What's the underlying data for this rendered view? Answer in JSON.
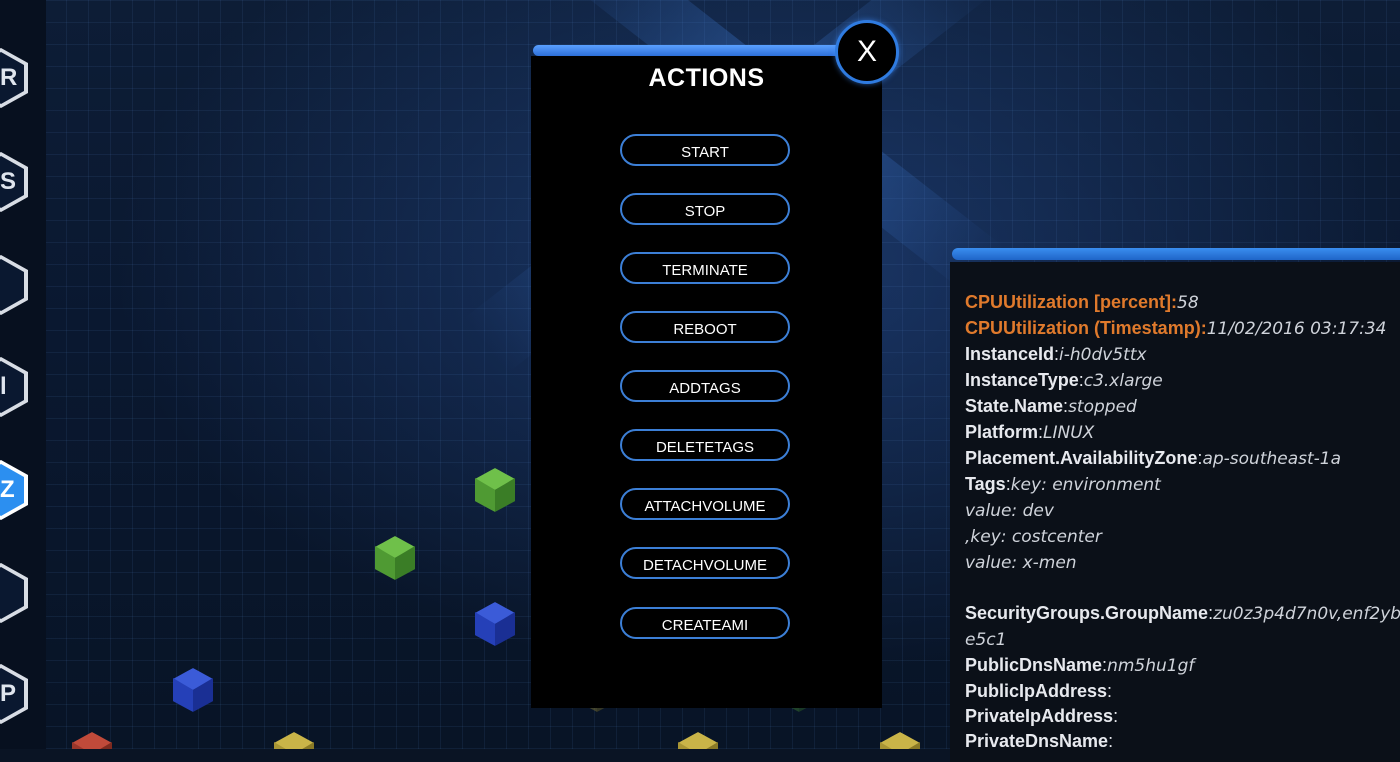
{
  "colors": {
    "accent": "#2f7be0",
    "highlight": "#e07a2c",
    "panel": "#000000"
  },
  "sidebar": {
    "items": [
      {
        "icon": "hex-r-icon",
        "glyph": "R"
      },
      {
        "icon": "hex-s-icon",
        "glyph": "S"
      },
      {
        "icon": "hex-database-icon",
        "glyph": ""
      },
      {
        "icon": "hex-bars-icon",
        "glyph": "l"
      },
      {
        "icon": "hex-active-icon",
        "glyph": "Z"
      },
      {
        "icon": "hex-lock-icon",
        "glyph": ""
      },
      {
        "icon": "hex-p-icon",
        "glyph": "P"
      }
    ]
  },
  "actions": {
    "title": "ACTIONS",
    "close_label": "X",
    "buttons": [
      "START",
      "STOP",
      "TERMINATE",
      "REBOOT",
      "ADDTAGS",
      "DELETETAGS",
      "ATTACHVOLUME",
      "DETACHVOLUME",
      "CREATEAMI"
    ]
  },
  "details": {
    "cpu_percent_key": "CPUUtilization [percent]",
    "cpu_percent_value": "58",
    "cpu_ts_key": "CPUUtilization (Timestamp)",
    "cpu_ts_value": "11/02/2016 03:17:34",
    "instance_id_key": "InstanceId",
    "instance_id_value": "i-h0dv5ttx",
    "instance_type_key": "InstanceType",
    "instance_type_value": "c3.xlarge",
    "state_key": "State.Name",
    "state_value": "stopped",
    "platform_key": "Platform",
    "platform_value": "LINUX",
    "zone_key": "Placement.AvailabilityZone",
    "zone_value": "ap-southeast-1a",
    "tags_key": "Tags",
    "tags_line1": "key: environment",
    "tags_line2": "value: dev",
    "tags_line3": ",key: costcenter",
    "tags_line4": "value: x-men",
    "sg_key": "SecurityGroups.GroupName",
    "sg_value": "zu0z3p4d7n0v,enf2ybe5c1",
    "public_dns_key": "PublicDnsName",
    "public_dns_value": "nm5hu1gf",
    "public_ip_key": "PublicIpAddress",
    "private_ip_key": "PrivateIpAddress",
    "private_dns_key": "PrivateDnsName"
  }
}
